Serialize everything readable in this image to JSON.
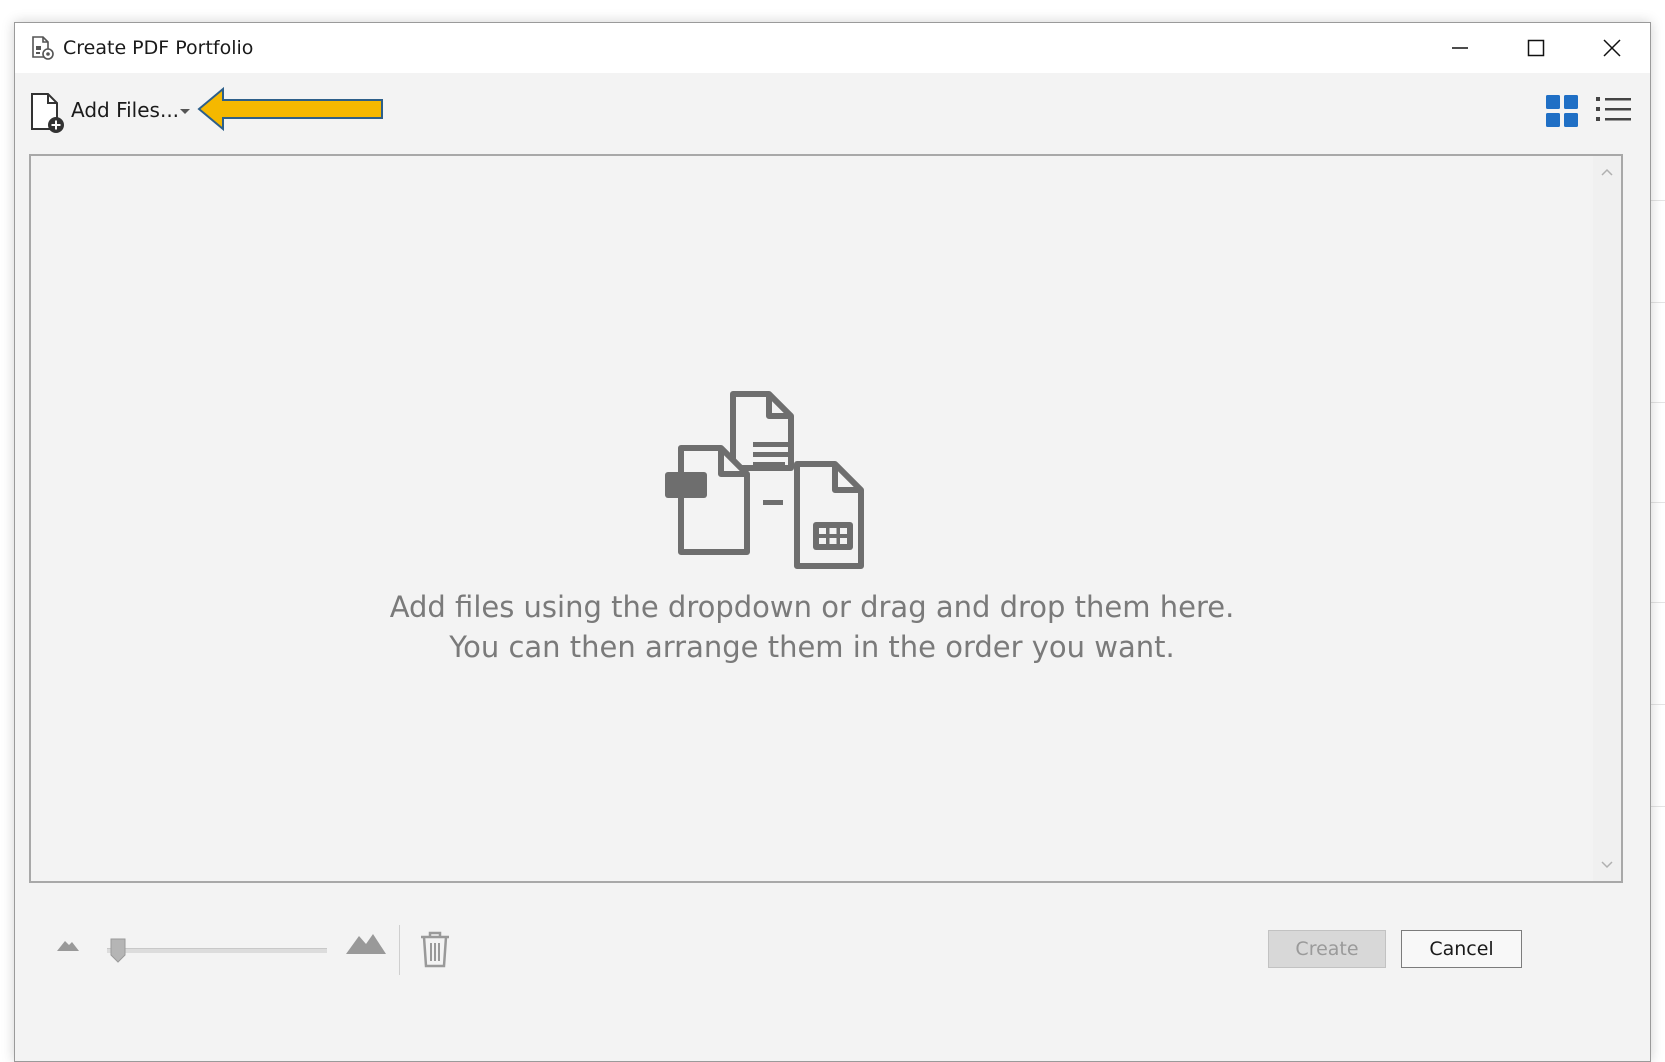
{
  "window": {
    "title": "Create PDF Portfolio",
    "title_icon": "pdf-portfolio-icon",
    "controls": [
      "minimize-icon",
      "maximize-icon",
      "close-icon"
    ]
  },
  "toolbar": {
    "add_files_label": "Add Files...",
    "add_files_icon": "add-file-icon",
    "dropdown_icon": "chevron-down-icon",
    "annotation": "yellow-arrow-pointing-left",
    "view_modes": [
      "grid-view-icon",
      "list-view-icon"
    ],
    "active_view": "grid-view-icon"
  },
  "dropzone": {
    "illustration": "files-illustration-icon",
    "hint_line1": "Add files using the dropdown or drag and drop them here.",
    "hint_line2": "You can then arrange them in the order you want."
  },
  "footer": {
    "zoom_level": 0.05,
    "create_label": "Create",
    "cancel_label": "Cancel"
  },
  "colors": {
    "accent_blue": "#1f6fc5",
    "arrow_fill": "#f5b800",
    "arrow_outline": "#2d5f8a",
    "dialog_bg": "#f3f3f3",
    "hint_text": "#7a7a7a"
  }
}
